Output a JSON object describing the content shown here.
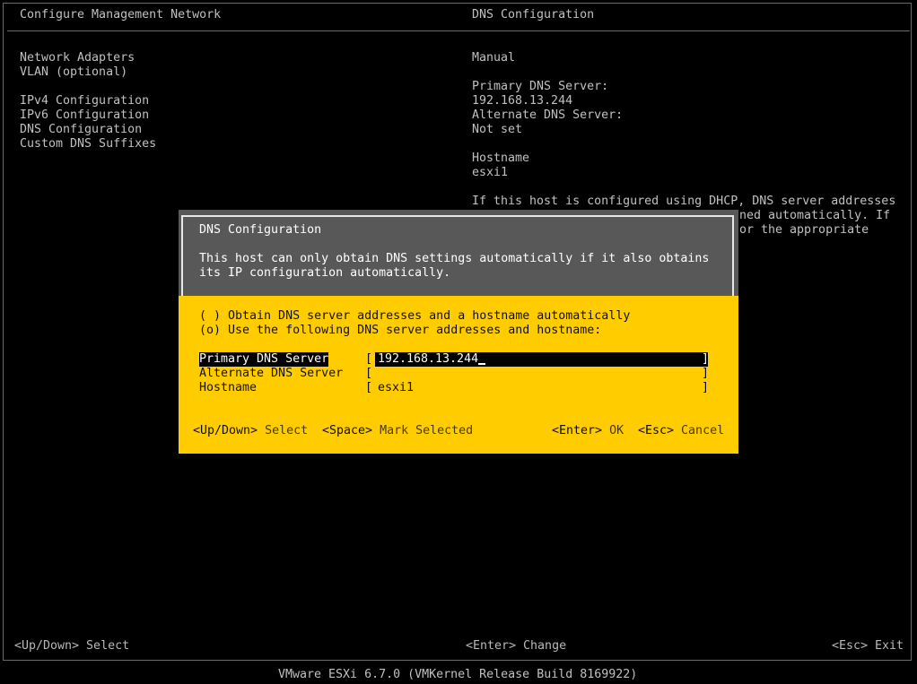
{
  "header": {
    "left_title": "Configure Management Network",
    "right_title": "DNS Configuration"
  },
  "menu": {
    "items": [
      "Network Adapters",
      "VLAN (optional)",
      "IPv4 Configuration",
      "IPv6 Configuration",
      "DNS Configuration",
      "Custom DNS Suffixes"
    ]
  },
  "info_panel": {
    "mode": "Manual",
    "primary_label": "Primary DNS Server:",
    "primary_value": "192.168.13.244",
    "alternate_label": "Alternate DNS Server:",
    "alternate_value": "Not set",
    "hostname_label": "Hostname",
    "hostname_value": "esxi1",
    "help_line1": "If this host is configured using DHCP, DNS server addresses",
    "help_line2_tail": "ned automatically. If",
    "help_line3_tail": "or the appropriate"
  },
  "dialog": {
    "title": "DNS Configuration",
    "message_line1": "This host can only obtain DNS settings automatically if it also obtains",
    "message_line2": "its IP configuration automatically.",
    "option_auto": "( ) Obtain DNS server addresses and a hostname automatically",
    "option_manual": "(o) Use the following DNS server addresses and hostname:",
    "fields": [
      {
        "label": "Primary DNS Server",
        "value": "192.168.13.244"
      },
      {
        "label": "Alternate DNS Server",
        "value": ""
      },
      {
        "label": "Hostname",
        "value": "esxi1"
      }
    ],
    "bracket_left": "[",
    "bracket_right": "]",
    "keys": {
      "updown_key": "<Up/Down>",
      "updown_desc": "Select",
      "space_key": "<Space>",
      "space_desc": "Mark Selected",
      "enter_key": "<Enter>",
      "enter_desc": "OK",
      "esc_key": "<Esc>",
      "esc_desc": "Cancel"
    }
  },
  "footer": {
    "left": "<Up/Down> Select",
    "center": "<Enter> Change",
    "right": "<Esc> Exit",
    "version": "VMware ESXi 6.7.0 (VMKernel Release Build 8169922)"
  }
}
